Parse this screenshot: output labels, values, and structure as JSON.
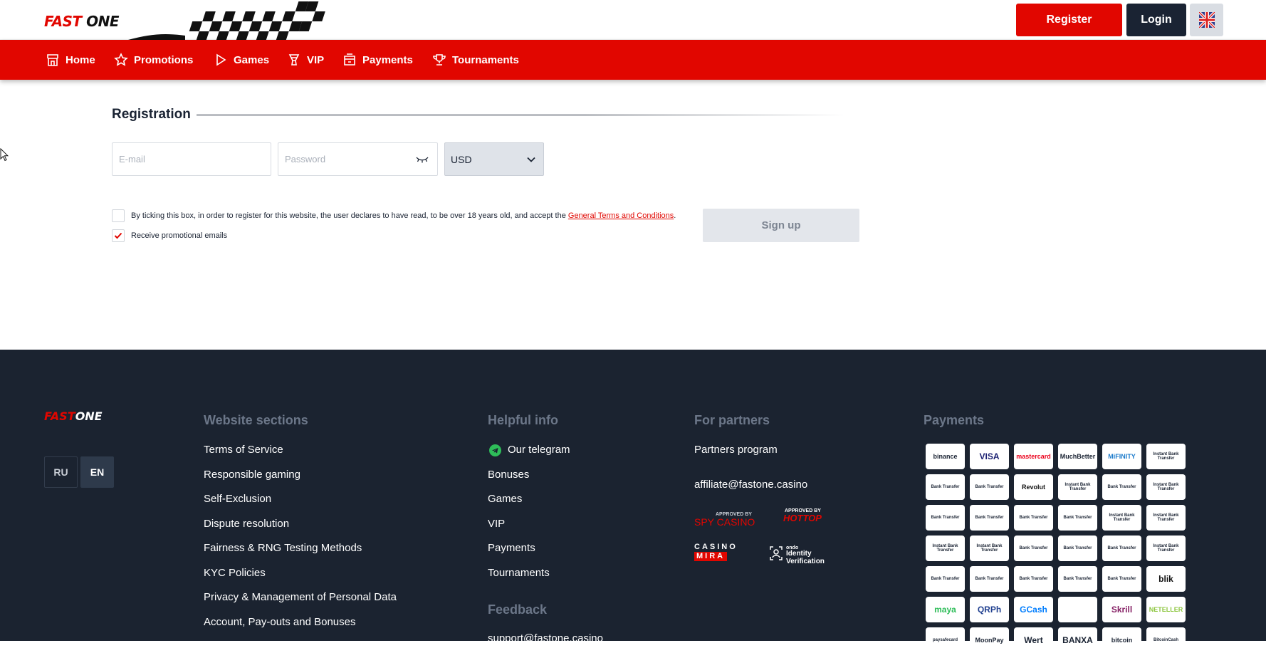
{
  "header": {
    "logo_fast": "FAST",
    "logo_one": "ONE",
    "register_label": "Register",
    "login_label": "Login",
    "language_icon": "uk-flag-icon"
  },
  "nav": {
    "items": [
      {
        "label": "Home",
        "icon": "home-icon"
      },
      {
        "label": "Promotions",
        "icon": "star-icon"
      },
      {
        "label": "Games",
        "icon": "play-icon"
      },
      {
        "label": "VIP",
        "icon": "vip-icon"
      },
      {
        "label": "Payments",
        "icon": "payments-icon"
      },
      {
        "label": "Tournaments",
        "icon": "trophy-icon"
      }
    ]
  },
  "registration": {
    "title": "Registration",
    "email_placeholder": "E-mail",
    "password_placeholder": "Password",
    "currency": "USD",
    "terms_text": "By ticking this box, in order to register for this website, the user declares to have read, to be over 18 years old, and accept the",
    "terms_link": "General Terms and Conditions",
    "terms_end": ".",
    "terms_checked": false,
    "promo_text": "Receive promotional emails",
    "promo_checked": true,
    "signup_label": "Sign up"
  },
  "footer": {
    "logo_fast": "FAST",
    "logo_one": "ONE",
    "languages": [
      "RU",
      "EN"
    ],
    "active_language": "EN",
    "website_sections": {
      "heading": "Website sections",
      "links": [
        "Terms of Service",
        "Responsible gaming",
        "Self-Exclusion",
        "Dispute resolution",
        "Fairness & RNG Testing Methods",
        "KYC Policies",
        "Privacy & Management of Personal Data",
        "Account, Pay-outs and Bonuses"
      ]
    },
    "helpful_info": {
      "heading": "Helpful info",
      "links": [
        "Our telegram",
        "Bonuses",
        "Games",
        "VIP",
        "Payments",
        "Tournaments"
      ],
      "feedback_heading": "Feedback",
      "feedback_email": "support@fastone.casino"
    },
    "partners": {
      "heading": "For partners",
      "program": "Partners program",
      "email": "affiliate@fastone.casino",
      "badges": [
        {
          "top": "APPROVED BY",
          "main": "SPY CASINO"
        },
        {
          "top": "APPROVED BY",
          "main": "HOTTOP"
        },
        {
          "top": "CASINO",
          "main": "MIRA"
        },
        {
          "top": "ondo",
          "main": "Identity Verification"
        }
      ]
    },
    "payments": {
      "heading": "Payments",
      "methods": [
        [
          "binance",
          "VISA",
          "mastercard",
          "MuchBetter",
          "MiFINITY",
          "Instant Bank Transfer"
        ],
        [
          "Bank Transfer",
          "Bank Transfer",
          "Revolut",
          "Instant Bank Transfer",
          "Bank Transfer",
          "Instant Bank Transfer"
        ],
        [
          "Bank Transfer",
          "Bank Transfer",
          "Bank Transfer",
          "Bank Transfer",
          "Instant Bank Transfer",
          "Instant Bank Transfer"
        ],
        [
          "Instant Bank Transfer",
          "Instant Bank Transfer",
          "Bank Transfer",
          "Bank Transfer",
          "Bank Transfer",
          "Instant Bank Transfer"
        ],
        [
          "Bank Transfer",
          "Bank Transfer",
          "Bank Transfer",
          "Bank Transfer",
          "Bank Transfer",
          "blik"
        ],
        [
          "maya",
          "QRPh",
          "GCash",
          "",
          "Skrill",
          "NETELLER"
        ],
        [
          "paysafecard",
          "MoonPay",
          "Wert",
          "BANXA",
          "bitcoin",
          "BitcoinCash"
        ]
      ]
    }
  }
}
